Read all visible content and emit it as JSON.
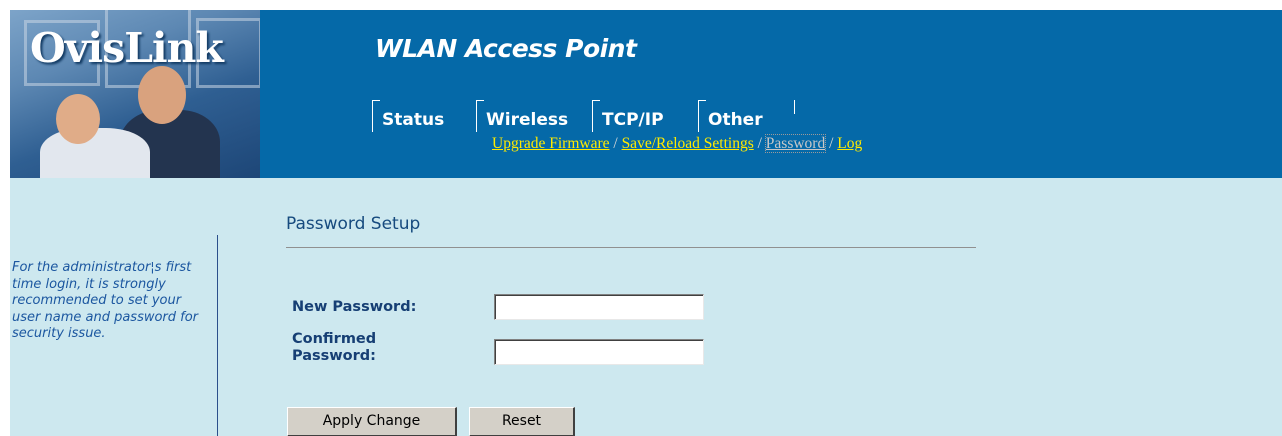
{
  "brand": {
    "logo_text": "OvisLink"
  },
  "header": {
    "product_title": "WLAN Access Point"
  },
  "tabs": [
    {
      "label": "Status"
    },
    {
      "label": "Wireless"
    },
    {
      "label": "TCP/IP"
    },
    {
      "label": "Other"
    }
  ],
  "subnav": {
    "items": [
      {
        "label": "Upgrade Firmware"
      },
      {
        "label": "Save/Reload Settings"
      },
      {
        "label": "Password",
        "current": true
      },
      {
        "label": "Log"
      }
    ],
    "separator": " / "
  },
  "sidebar": {
    "note": "For the administrator¦s first time login, it is strongly recommended to set your user name and password for security issue."
  },
  "main": {
    "title": "Password Setup",
    "fields": {
      "new_password": {
        "label": "New Password:",
        "value": ""
      },
      "confirmed_password": {
        "label": "Confirmed Password:",
        "value": ""
      }
    },
    "buttons": {
      "apply": "Apply Change",
      "reset": "Reset"
    }
  },
  "colors": {
    "header_bg": "#0569a8",
    "body_bg": "#cde8ef",
    "link": "#ffea00",
    "label": "#163f74",
    "note": "#1c57a0"
  }
}
